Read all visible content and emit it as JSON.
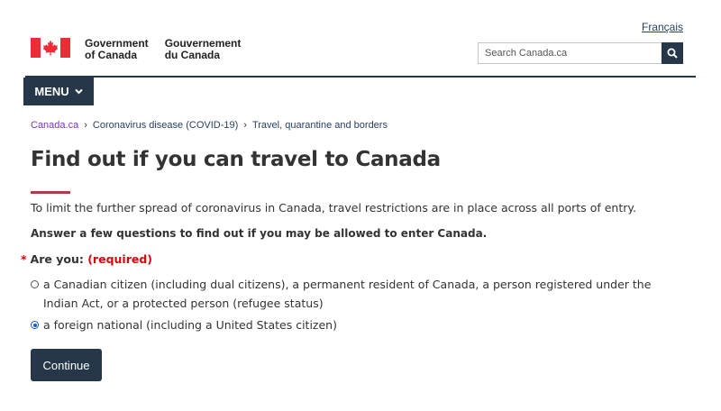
{
  "header": {
    "language_link": "Français",
    "brand_en_line1": "Government",
    "brand_en_line2": "of Canada",
    "brand_fr_line1": "Gouvernement",
    "brand_fr_line2": "du Canada",
    "search_placeholder": "Search Canada.ca",
    "menu_label": "MENU"
  },
  "breadcrumb": [
    {
      "label": "Canada.ca"
    },
    {
      "label": "Coronavirus disease (COVID-19)"
    },
    {
      "label": "Travel, quarantine and borders"
    }
  ],
  "main": {
    "title": "Find out if you can travel to Canada",
    "intro": "To limit the further spread of coronavirus in Canada, travel restrictions are in place across all ports of entry.",
    "prompt": "Answer a few questions to find out if you may be allowed to enter Canada.",
    "question_star": "*",
    "question_label": "Are you:",
    "question_required": "(required)",
    "options": [
      {
        "label": "a Canadian citizen (including dual citizens), a permanent resident of Canada, a person registered under the Indian Act, or a protected person (refugee status)",
        "selected": false
      },
      {
        "label": "a foreign national (including a United States citizen)",
        "selected": true
      }
    ],
    "continue_label": "Continue"
  },
  "colors": {
    "navy": "#26374a",
    "accent_red": "#af3c43",
    "required_red": "#d3080c",
    "link": "#284162",
    "visited_link": "#7834bc"
  }
}
